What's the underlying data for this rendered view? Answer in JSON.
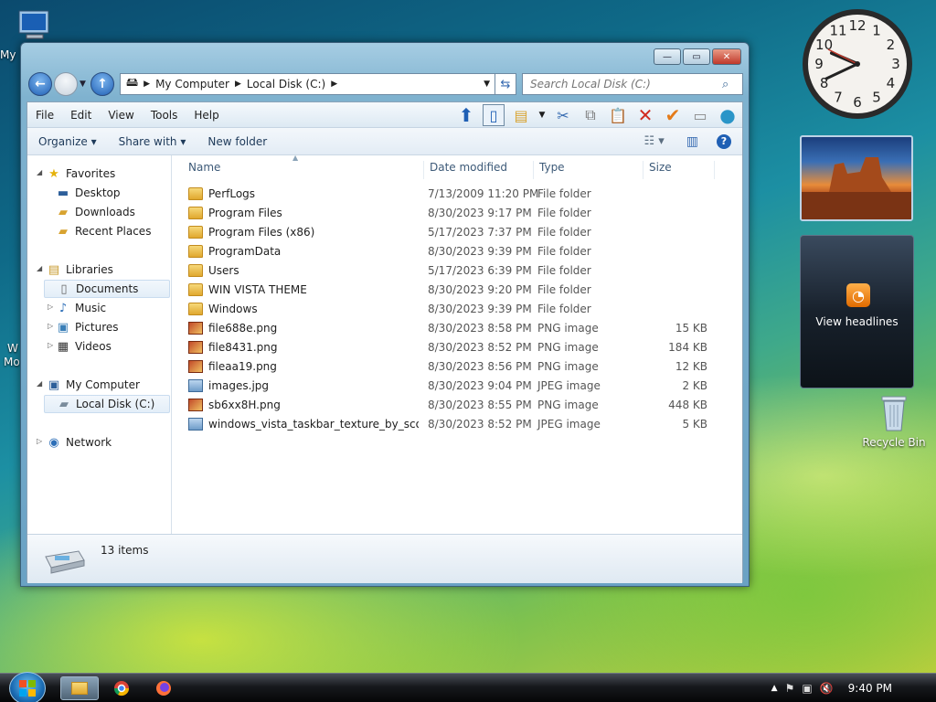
{
  "desktop": {
    "my_computer_label": "My",
    "edge_labels": [
      "W",
      "Mo"
    ],
    "recycle_bin_label": "Recycle Bin"
  },
  "window": {
    "title_buttons": {
      "minimize": "—",
      "maximize": "▭",
      "close": "✕"
    },
    "address": {
      "segments": [
        "My Computer",
        "Local Disk (C:)"
      ]
    },
    "search": {
      "placeholder": "Search Local Disk (C:)"
    },
    "menu": [
      "File",
      "Edit",
      "View",
      "Tools",
      "Help"
    ],
    "commands": {
      "organize": "Organize",
      "share": "Share with",
      "new_folder": "New folder"
    },
    "nav": {
      "favorites": "Favorites",
      "desktop": "Desktop",
      "downloads": "Downloads",
      "recent": "Recent Places",
      "libraries": "Libraries",
      "documents": "Documents",
      "music": "Music",
      "pictures": "Pictures",
      "videos": "Videos",
      "my_computer": "My Computer",
      "local_disk": "Local Disk (C:)",
      "network": "Network"
    },
    "columns": {
      "name": "Name",
      "date": "Date modified",
      "type": "Type",
      "size": "Size"
    },
    "files": [
      {
        "name": "PerfLogs",
        "date": "7/13/2009 11:20 PM",
        "type": "File folder",
        "size": "",
        "kind": "folder"
      },
      {
        "name": "Program Files",
        "date": "8/30/2023 9:17 PM",
        "type": "File folder",
        "size": "",
        "kind": "folder"
      },
      {
        "name": "Program Files (x86)",
        "date": "5/17/2023 7:37 PM",
        "type": "File folder",
        "size": "",
        "kind": "folder"
      },
      {
        "name": "ProgramData",
        "date": "8/30/2023 9:39 PM",
        "type": "File folder",
        "size": "",
        "kind": "folder"
      },
      {
        "name": "Users",
        "date": "5/17/2023 6:39 PM",
        "type": "File folder",
        "size": "",
        "kind": "folder"
      },
      {
        "name": "WIN VISTA THEME",
        "date": "8/30/2023 9:20 PM",
        "type": "File folder",
        "size": "",
        "kind": "folder"
      },
      {
        "name": "Windows",
        "date": "8/30/2023 9:39 PM",
        "type": "File folder",
        "size": "",
        "kind": "folder"
      },
      {
        "name": "file688e.png",
        "date": "8/30/2023 8:58 PM",
        "type": "PNG image",
        "size": "15 KB",
        "kind": "png"
      },
      {
        "name": "file8431.png",
        "date": "8/30/2023 8:52 PM",
        "type": "PNG image",
        "size": "184 KB",
        "kind": "png"
      },
      {
        "name": "fileaa19.png",
        "date": "8/30/2023 8:56 PM",
        "type": "PNG image",
        "size": "12 KB",
        "kind": "png"
      },
      {
        "name": "images.jpg",
        "date": "8/30/2023 9:04 PM",
        "type": "JPEG image",
        "size": "2 KB",
        "kind": "jpg"
      },
      {
        "name": "sb6xx8H.png",
        "date": "8/30/2023 8:55 PM",
        "type": "PNG image",
        "size": "448 KB",
        "kind": "png"
      },
      {
        "name": "windows_vista_taskbar_texture_by_scott_...",
        "date": "8/30/2023 8:52 PM",
        "type": "JPEG image",
        "size": "5 KB",
        "kind": "jpg"
      }
    ],
    "status": {
      "item_count": "13 items"
    }
  },
  "gadgets": {
    "clock_numbers": [
      "12",
      "1",
      "2",
      "3",
      "4",
      "5",
      "6",
      "7",
      "8",
      "9",
      "10",
      "11"
    ],
    "feed_text": "View headlines"
  },
  "taskbar": {
    "time": "9:40 PM"
  }
}
